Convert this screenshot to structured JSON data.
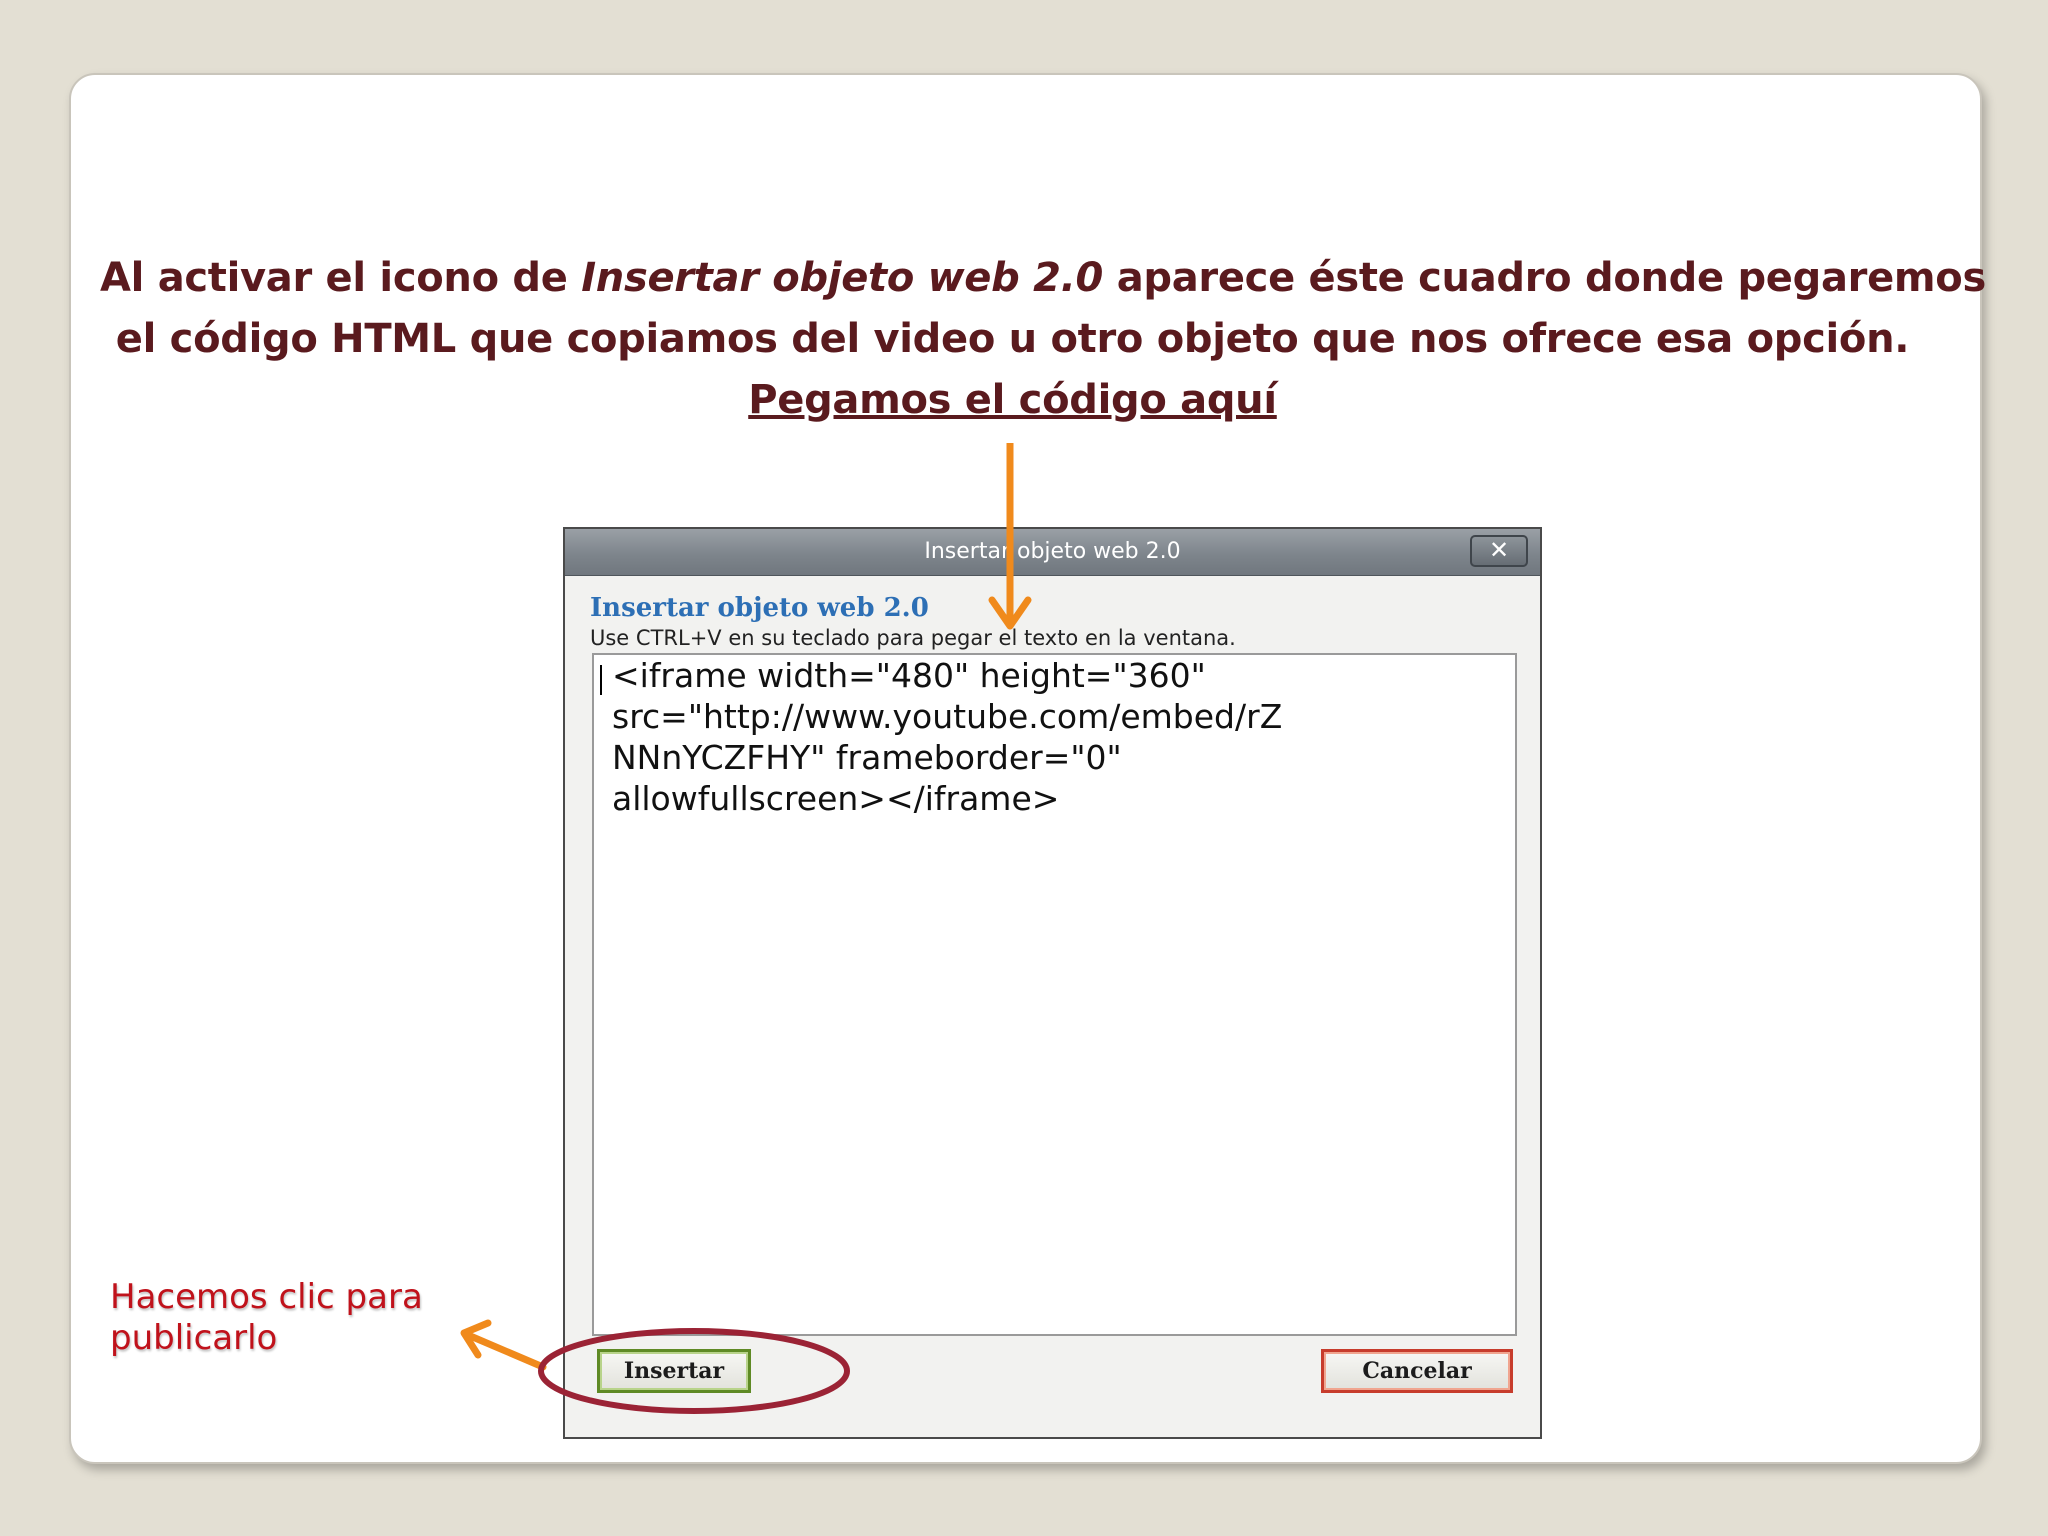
{
  "slide": {
    "instruction": {
      "part1": "Al activar el icono de ",
      "emphasis": "Insertar objeto web 2.0",
      "part2": " aparece éste cuadro donde pegaremos",
      "line2": "el código HTML que copiamos del video u otro objeto que nos ofrece esa opción.",
      "line3": "Pegamos el código aquí"
    },
    "click_note": {
      "line1": "Hacemos clic para",
      "line2": "publicarlo"
    }
  },
  "dialog": {
    "title": "Insertar objeto web 2.0",
    "close_label": "✕",
    "heading": "Insertar objeto web 2.0",
    "hint": "Use CTRL+V en su teclado para pegar el texto en la ventana.",
    "code": "<iframe width=\"480\" height=\"360\"\nsrc=\"http://www.youtube.com/embed/rZ\nNNnYCZFHY\" frameborder=\"0\"\nallowfullscreen></iframe>",
    "insert_label": "Insertar",
    "cancel_label": "Cancelar"
  },
  "colors": {
    "background": "#e3dfd3",
    "heading_text": "#5a1a1e",
    "arrow": "#f08a1c",
    "circle": "#9b2335",
    "note_text": "#c0121b",
    "dialog_heading": "#2d6fb5"
  }
}
